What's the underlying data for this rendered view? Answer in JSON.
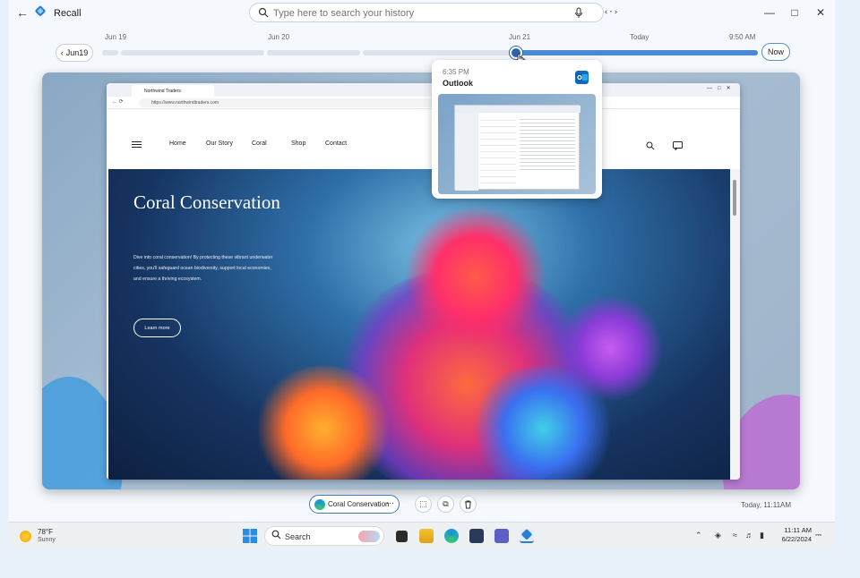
{
  "app": {
    "title": "Recall"
  },
  "search": {
    "placeholder": "Type here to search your history"
  },
  "timeline": {
    "labels": [
      "Jun 19",
      "Jun 20",
      "Jun 21",
      "Today",
      "9:50 AM"
    ],
    "prev_label": "Jun19",
    "now_label": "Now"
  },
  "snapshot": {
    "browser_tab": "Northwind Traders",
    "url": "https://www.northwindtraders.com",
    "nav": [
      "Home",
      "Our Story",
      "Coral",
      "Shop",
      "Contact"
    ],
    "hero_title": "Coral Conservation",
    "hero_body": "Dive into coral conservation! By protecting these vibrant underwater cities, you'll safeguard ocean biodiversity, support local economies, and ensure a thriving ecosystem.",
    "cta": "Learn more"
  },
  "popup": {
    "time": "6:35 PM",
    "app": "Outlook"
  },
  "toolbar": {
    "snapshot_label": "Coral Conservation",
    "timestamp": "Today, 11:11AM"
  },
  "taskbar": {
    "weather_temp": "78°F",
    "weather_cond": "Sunny",
    "search_label": "Search",
    "clock_time": "11:11 AM",
    "clock_date": "6/22/2024"
  },
  "colors": {
    "accent": "#2d63b0",
    "timeline_active": "#4a8ad4"
  }
}
